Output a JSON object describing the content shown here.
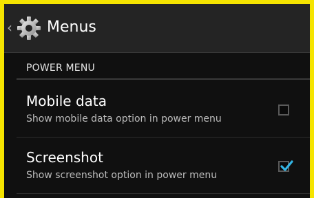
{
  "header": {
    "title": "Menus",
    "back_icon": "chevron-left-icon",
    "app_icon": "gear-icon"
  },
  "section": {
    "title": "POWER MENU"
  },
  "items": [
    {
      "title": "Mobile data",
      "summary": "Show mobile data option in power menu",
      "checked": false
    },
    {
      "title": "Screenshot",
      "summary": "Show screenshot option in power menu",
      "checked": true
    }
  ],
  "colors": {
    "frame_border": "#f5e400",
    "action_bar": "#242424",
    "background": "#101010",
    "accent": "#33b5e5"
  }
}
